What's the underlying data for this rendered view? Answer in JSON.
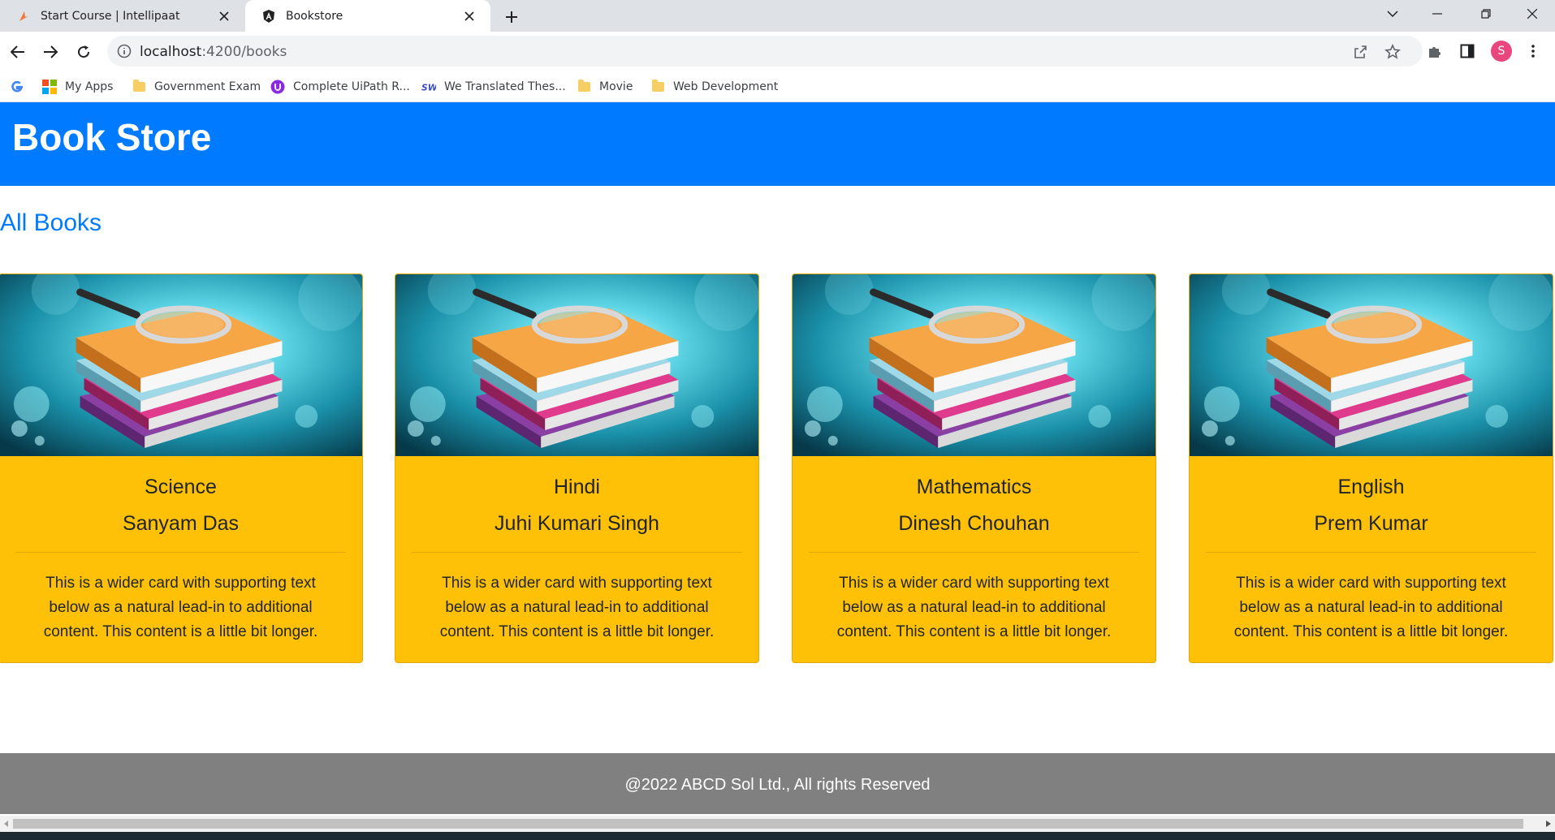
{
  "browser": {
    "tabs": [
      {
        "title": "Start Course | Intellipaat",
        "icon": "intellipaat-favicon",
        "active": false
      },
      {
        "title": "Bookstore",
        "icon": "angular-favicon",
        "active": true
      }
    ],
    "url_host": "localhost",
    "url_path": ":4200/books",
    "profile_initial": "S",
    "bookmarks": [
      {
        "label": "My Apps",
        "icon": "apps-grid-icon"
      },
      {
        "label": "Government Exam",
        "icon": "folder-icon"
      },
      {
        "label": "Complete UiPath R...",
        "icon": "uipath-icon"
      },
      {
        "label": "We Translated Thes...",
        "icon": "sw-icon"
      },
      {
        "label": "Movie",
        "icon": "folder-icon"
      },
      {
        "label": "Web Development",
        "icon": "folder-icon"
      }
    ]
  },
  "page": {
    "brand": "Book Store",
    "heading": "All Books",
    "books": [
      {
        "title": "Science",
        "author": "Sanyam Das",
        "description": "This is a wider card with supporting text below as a natural lead-in to additional content. This content is a little bit longer."
      },
      {
        "title": "Hindi",
        "author": "Juhi Kumari Singh",
        "description": "This is a wider card with supporting text below as a natural lead-in to additional content. This content is a little bit longer."
      },
      {
        "title": "Mathematics",
        "author": "Dinesh Chouhan",
        "description": "This is a wider card with supporting text below as a natural lead-in to additional content. This content is a little bit longer."
      },
      {
        "title": "English",
        "author": "Prem Kumar",
        "description": "This is a wider card with supporting text below as a natural lead-in to additional content. This content is a little bit longer."
      }
    ],
    "footer": "@2022 ABCD Sol Ltd., All rights Reserved"
  },
  "colors": {
    "navbar": "#007bff",
    "card": "#ffc107",
    "footer": "#808080",
    "heading": "#007bff"
  }
}
